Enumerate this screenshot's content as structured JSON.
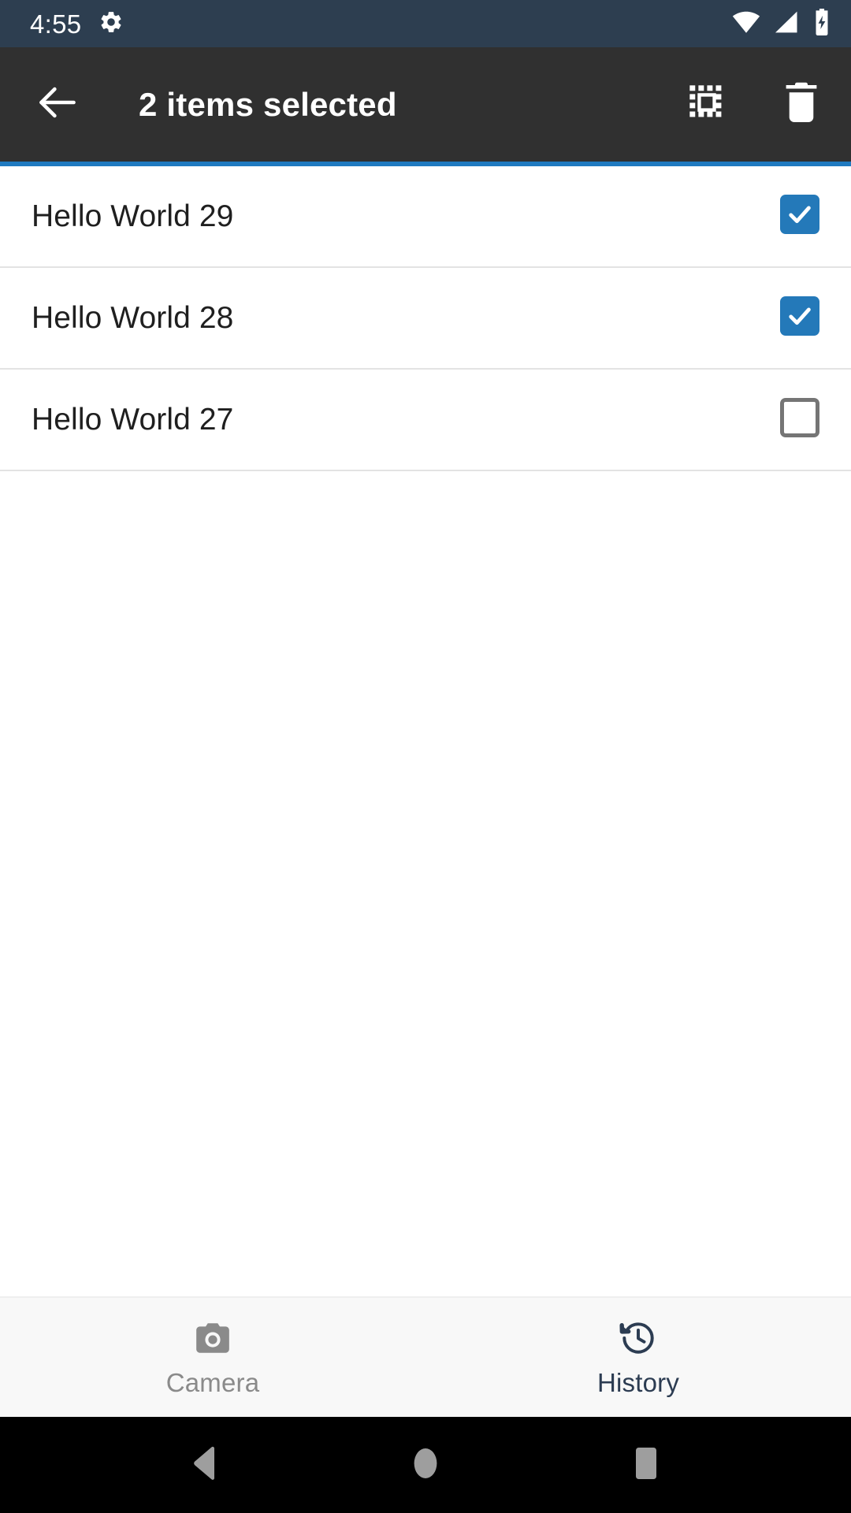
{
  "status_bar": {
    "clock": "4:55",
    "background": "#2d3e50",
    "icons": {
      "settings": "gear-icon",
      "wifi": "wifi-icon",
      "signal": "cellular-signal-icon",
      "battery": "battery-charging-icon"
    }
  },
  "app_bar": {
    "title": "2 items selected",
    "background": "#303030",
    "accent_color": "#1f7ac0",
    "back_icon": "arrow-back-icon",
    "actions": [
      {
        "name": "select-all-button",
        "icon": "select-all-icon"
      },
      {
        "name": "delete-button",
        "icon": "trash-icon"
      }
    ]
  },
  "list": {
    "checked_color": "#2479b9",
    "unchecked_border_color": "#757575",
    "items": [
      {
        "label": "Hello World 29",
        "checked": true
      },
      {
        "label": "Hello World 28",
        "checked": true
      },
      {
        "label": "Hello World 27",
        "checked": false
      }
    ]
  },
  "bottom_nav": {
    "background": "#f8f8f8",
    "active_color": "#2c3c52",
    "inactive_color": "#8a8a8a",
    "tabs": [
      {
        "label": "Camera",
        "icon": "camera-icon",
        "active": false
      },
      {
        "label": "History",
        "icon": "history-icon",
        "active": true
      }
    ]
  },
  "system_nav": {
    "background": "#000000",
    "buttons": [
      {
        "name": "back",
        "icon": "triangle-back-icon"
      },
      {
        "name": "home",
        "icon": "circle-home-icon"
      },
      {
        "name": "recents",
        "icon": "square-recents-icon"
      }
    ]
  }
}
